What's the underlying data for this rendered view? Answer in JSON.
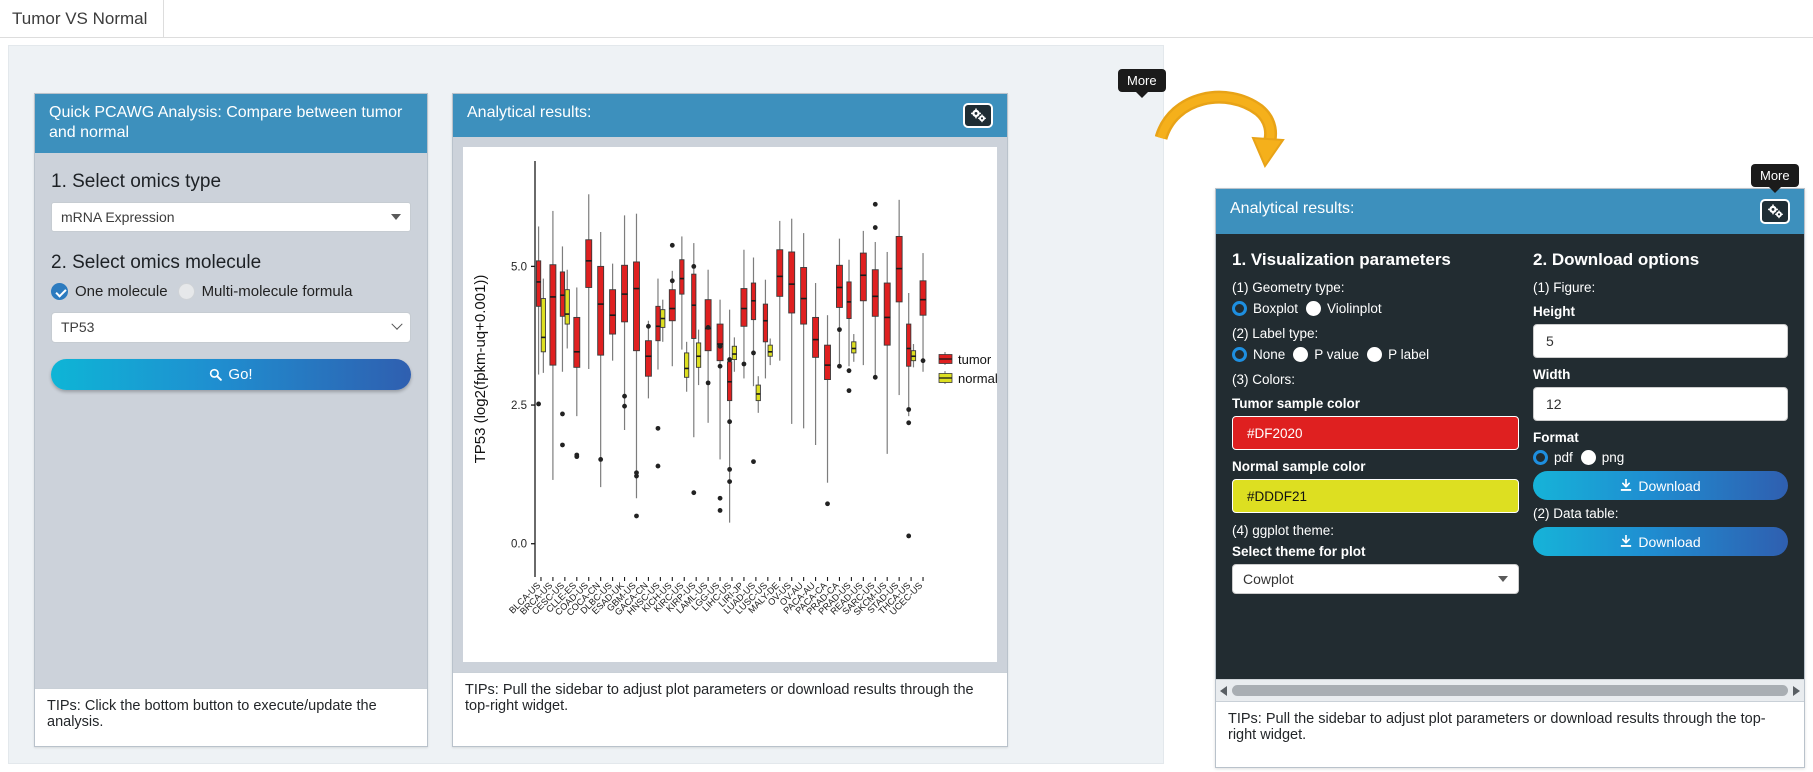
{
  "tab": {
    "label": "Tumor VS Normal"
  },
  "left_panel": {
    "title": "Quick PCAWG Analysis: Compare between tumor and normal",
    "step1_title": "1. Select omics type",
    "omics_type_value": "mRNA Expression",
    "step2_title": "2. Select omics molecule",
    "radio_one": "One molecule",
    "radio_multi": "Multi-molecule formula",
    "molecule_value": "TP53",
    "go_label": "Go!",
    "go_icon": "search-icon",
    "tips": "TIPs: Click the bottom button to execute/update the analysis."
  },
  "mid_panel": {
    "title": "Analytical results:",
    "gear_icon": "gears-icon",
    "more_tooltip": "More",
    "tips": "TIPs: Pull the sidebar to adjust plot parameters or download results through the top-right widget."
  },
  "right_panel": {
    "title": "Analytical results:",
    "gear_icon": "gears-icon",
    "more_tooltip": "More",
    "viz_heading": "1. Visualization parameters",
    "geometry_label": "(1) Geometry type:",
    "geometry_options": [
      "Boxplot",
      "Violinplot"
    ],
    "geometry_selected": "Boxplot",
    "label_type_label": "(2) Label type:",
    "label_options": [
      "None",
      "P value",
      "P label"
    ],
    "label_selected": "None",
    "colors_label": "(3) Colors:",
    "tumor_color_label": "Tumor sample color",
    "tumor_color_value": "#DF2020",
    "normal_color_label": "Normal sample color",
    "normal_color_value": "#DDDF21",
    "theme_label": "(4) ggplot theme:",
    "theme_select_label": "Select theme for plot",
    "theme_value": "Cowplot",
    "download_heading": "2. Download options",
    "figure_label": "(1) Figure:",
    "height_label": "Height",
    "height_value": "5",
    "width_label": "Width",
    "width_value": "12",
    "format_label": "Format",
    "format_options": [
      "pdf",
      "png"
    ],
    "format_selected": "pdf",
    "download_figure_label": "Download",
    "data_table_label": "(2) Data table:",
    "download_table_label": "Download",
    "download_icon": "download-icon",
    "tips": "TIPs: Pull the sidebar to adjust plot parameters or download results through the top-right widget."
  },
  "chart_data": {
    "type": "box",
    "title": "",
    "xlabel": "",
    "ylabel": "TP53 (log2(fpkm-uq+0.001))",
    "ylim": [
      -0.6,
      6.9
    ],
    "yticks": [
      0.0,
      2.5,
      5.0
    ],
    "ytick_labels": [
      "0.0",
      "2.5",
      "5.0"
    ],
    "grid": false,
    "legend_position": "right",
    "legend": [
      {
        "name": "tumor",
        "color": "#DF2020"
      },
      {
        "name": "normal",
        "color": "#DDDF21"
      }
    ],
    "categories": [
      "BLCA-US",
      "BRCA-US",
      "CESC-US",
      "CLLE-ES",
      "COAD-US",
      "COCA-CN",
      "DLBC-US",
      "ESAD-UK",
      "GBM-US",
      "GACA-CN",
      "HNSC-US",
      "KICH-US",
      "KIRC-US",
      "KIRP-US",
      "LAML-US",
      "LGG-US",
      "LIHC-US",
      "LIRI-JP",
      "LUAD-US",
      "LUSC-US",
      "MALY-DE",
      "OV-US",
      "OV-AU",
      "PACA-AU",
      "PACA-CA",
      "PRAD-CA",
      "PRAD-US",
      "READ-US",
      "SARC-US",
      "SKCM-US",
      "STAD-US",
      "THCA-US",
      "UCEC-US"
    ],
    "series": [
      {
        "name": "tumor",
        "color": "#DF2020",
        "boxes": [
          {
            "x": "BLCA-US",
            "lo": 3.05,
            "q1": 4.28,
            "med": 4.72,
            "q3": 5.1,
            "hi": 5.72,
            "outliers": [
              2.52
            ]
          },
          {
            "x": "BRCA-US",
            "lo": 1.15,
            "q1": 3.22,
            "med": 4.45,
            "q3": 5.03,
            "hi": 6.0,
            "outliers": []
          },
          {
            "x": "CESC-US",
            "lo": 3.1,
            "q1": 4.1,
            "med": 4.48,
            "q3": 4.9,
            "hi": 5.36,
            "outliers": [
              2.34,
              1.78
            ]
          },
          {
            "x": "CLLE-ES",
            "lo": 2.3,
            "q1": 3.18,
            "med": 3.46,
            "q3": 4.08,
            "hi": 4.62,
            "outliers": [
              1.6,
              1.57
            ]
          },
          {
            "x": "COAD-US",
            "lo": 3.15,
            "q1": 4.62,
            "med": 5.1,
            "q3": 5.48,
            "hi": 6.3,
            "outliers": []
          },
          {
            "x": "COCA-CN",
            "lo": 1.02,
            "q1": 3.4,
            "med": 4.32,
            "q3": 5.0,
            "hi": 5.62,
            "outliers": [
              1.52
            ]
          },
          {
            "x": "DLBC-US",
            "lo": 3.3,
            "q1": 3.78,
            "med": 4.12,
            "q3": 4.58,
            "hi": 5.05,
            "outliers": []
          },
          {
            "x": "ESAD-UK",
            "lo": 2.05,
            "q1": 4.0,
            "med": 4.5,
            "q3": 5.02,
            "hi": 5.92,
            "outliers": [
              2.66,
              2.48
            ]
          },
          {
            "x": "GBM-US",
            "lo": 0.82,
            "q1": 3.48,
            "med": 4.6,
            "q3": 5.08,
            "hi": 5.95,
            "outliers": [
              1.28,
              1.22,
              0.5
            ]
          },
          {
            "x": "GACA-CN",
            "lo": 2.62,
            "q1": 3.02,
            "med": 3.38,
            "q3": 3.66,
            "hi": 4.02,
            "outliers": [
              3.92
            ]
          },
          {
            "x": "HNSC-US",
            "lo": 3.14,
            "q1": 3.66,
            "med": 3.92,
            "q3": 4.28,
            "hi": 4.78,
            "outliers": [
              2.08,
              1.4
            ]
          },
          {
            "x": "KICH-US",
            "lo": 3.2,
            "q1": 4.02,
            "med": 4.24,
            "q3": 4.58,
            "hi": 4.92,
            "outliers": [
              5.38,
              4.74
            ]
          },
          {
            "x": "KIRC-US",
            "lo": 3.5,
            "q1": 4.5,
            "med": 4.78,
            "q3": 5.12,
            "hi": 5.54,
            "outliers": []
          },
          {
            "x": "KIRP-US",
            "lo": 1.92,
            "q1": 3.7,
            "med": 4.3,
            "q3": 4.86,
            "hi": 5.42,
            "outliers": [
              5.0,
              0.92
            ]
          },
          {
            "x": "LAML-US",
            "lo": 2.18,
            "q1": 3.48,
            "med": 3.88,
            "q3": 4.4,
            "hi": 4.94,
            "outliers": [
              3.9,
              2.9
            ]
          },
          {
            "x": "LGG-US",
            "lo": 1.52,
            "q1": 3.3,
            "med": 3.6,
            "q3": 3.96,
            "hi": 4.4,
            "outliers": [
              3.56,
              3.2,
              0.82,
              0.6
            ]
          },
          {
            "x": "LIHC-US",
            "lo": 0.38,
            "q1": 2.58,
            "med": 2.92,
            "q3": 3.28,
            "hi": 4.22,
            "outliers": [
              3.32,
              2.2,
              1.34,
              1.12
            ]
          },
          {
            "x": "LIRI-JP",
            "lo": 2.98,
            "q1": 3.92,
            "med": 4.24,
            "q3": 4.6,
            "hi": 5.3,
            "outliers": [
              3.24
            ]
          },
          {
            "x": "LUAD-US",
            "lo": 2.84,
            "q1": 4.04,
            "med": 4.38,
            "q3": 4.7,
            "hi": 5.16,
            "outliers": [
              3.44,
              1.48
            ]
          },
          {
            "x": "LUSC-US",
            "lo": 2.98,
            "q1": 3.64,
            "med": 4.02,
            "q3": 4.32,
            "hi": 4.76,
            "outliers": []
          },
          {
            "x": "MALY-DE",
            "lo": 3.3,
            "q1": 4.46,
            "med": 4.82,
            "q3": 5.3,
            "hi": 5.82,
            "outliers": []
          },
          {
            "x": "OV-US",
            "lo": 2.16,
            "q1": 4.16,
            "med": 4.68,
            "q3": 5.26,
            "hi": 5.86,
            "outliers": []
          },
          {
            "x": "OV-AU",
            "lo": 2.08,
            "q1": 3.96,
            "med": 4.42,
            "q3": 4.98,
            "hi": 5.6,
            "outliers": []
          },
          {
            "x": "PACA-AU",
            "lo": 1.78,
            "q1": 3.36,
            "med": 3.68,
            "q3": 4.08,
            "hi": 4.7,
            "outliers": []
          },
          {
            "x": "PACA-CA",
            "lo": 1.1,
            "q1": 2.96,
            "med": 3.22,
            "q3": 3.58,
            "hi": 4.12,
            "outliers": [
              0.72
            ]
          },
          {
            "x": "PRAD-CA",
            "lo": 3.24,
            "q1": 4.26,
            "med": 4.62,
            "q3": 5.02,
            "hi": 5.5,
            "outliers": [
              3.86,
              3.2
            ]
          },
          {
            "x": "PRAD-US",
            "lo": 3.2,
            "q1": 4.06,
            "med": 4.36,
            "q3": 4.72,
            "hi": 5.12,
            "outliers": [
              3.12,
              2.76
            ]
          },
          {
            "x": "READ-US",
            "lo": 3.22,
            "q1": 4.38,
            "med": 4.84,
            "q3": 5.24,
            "hi": 5.64,
            "outliers": []
          },
          {
            "x": "SARC-US",
            "lo": 2.98,
            "q1": 4.1,
            "med": 4.46,
            "q3": 4.94,
            "hi": 5.44,
            "outliers": [
              6.12,
              5.7,
              3.0
            ]
          },
          {
            "x": "SKCM-US",
            "lo": 1.62,
            "q1": 3.58,
            "med": 4.08,
            "q3": 4.7,
            "hi": 5.26,
            "outliers": []
          },
          {
            "x": "STAD-US",
            "lo": 2.68,
            "q1": 4.36,
            "med": 4.96,
            "q3": 5.54,
            "hi": 6.2,
            "outliers": []
          },
          {
            "x": "THCA-US",
            "lo": 2.3,
            "q1": 3.2,
            "med": 3.52,
            "q3": 3.96,
            "hi": 4.52,
            "outliers": [
              2.42,
              2.18,
              0.14
            ]
          },
          {
            "x": "UCEC-US",
            "lo": 3.1,
            "q1": 4.12,
            "med": 4.4,
            "q3": 4.74,
            "hi": 5.24,
            "outliers": [
              3.3
            ]
          }
        ]
      },
      {
        "name": "normal",
        "color": "#DDDF21",
        "boxes": [
          {
            "x": "BLCA-US",
            "lo": 3.08,
            "q1": 3.46,
            "med": 3.72,
            "q3": 4.42,
            "hi": 4.78,
            "outliers": []
          },
          {
            "x": "CESC-US",
            "lo": 3.52,
            "q1": 3.96,
            "med": 4.14,
            "q3": 4.58,
            "hi": 4.94,
            "outliers": []
          },
          {
            "x": "HNSC-US",
            "lo": 3.64,
            "q1": 3.9,
            "med": 4.06,
            "q3": 4.22,
            "hi": 4.4,
            "outliers": []
          },
          {
            "x": "KIRC-US",
            "lo": 2.74,
            "q1": 3.0,
            "med": 3.16,
            "q3": 3.44,
            "hi": 3.64,
            "outliers": []
          },
          {
            "x": "KIRP-US",
            "lo": 2.86,
            "q1": 3.18,
            "med": 3.38,
            "q3": 3.62,
            "hi": 3.86,
            "outliers": []
          },
          {
            "x": "LIHC-US",
            "lo": 3.1,
            "q1": 3.32,
            "med": 3.42,
            "q3": 3.56,
            "hi": 3.72,
            "outliers": []
          },
          {
            "x": "LUAD-US",
            "lo": 2.36,
            "q1": 2.58,
            "med": 2.7,
            "q3": 2.86,
            "hi": 3.02,
            "outliers": []
          },
          {
            "x": "LUSC-US",
            "lo": 3.22,
            "q1": 3.38,
            "med": 3.46,
            "q3": 3.58,
            "hi": 3.7,
            "outliers": []
          },
          {
            "x": "PRAD-US",
            "lo": 3.28,
            "q1": 3.44,
            "med": 3.52,
            "q3": 3.64,
            "hi": 3.78,
            "outliers": []
          },
          {
            "x": "THCA-US",
            "lo": 3.18,
            "q1": 3.3,
            "med": 3.38,
            "q3": 3.48,
            "hi": 3.6,
            "outliers": []
          }
        ]
      }
    ]
  }
}
